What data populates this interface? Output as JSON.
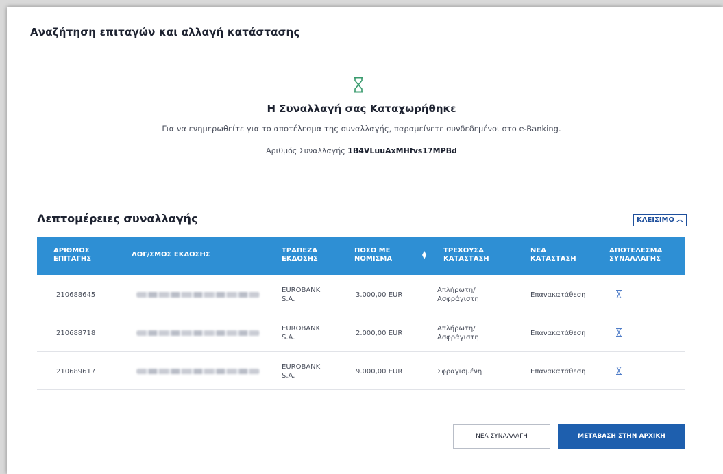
{
  "page": {
    "title": "Αναζήτηση επιταγών και αλλαγή κατάστασης"
  },
  "status": {
    "icon": "hourglass-icon",
    "title": "Η Συναλλαγή σας Καταχωρήθηκε",
    "subtitle": "Για να ενημερωθείτε για το αποτέλεσμα της συναλλαγής, παραμείνετε συνδεδεμένοι στο e-Banking.",
    "tx_label": "Αριθμός Συναλλαγής",
    "tx_id": "1B4VLuuAxMHfvs17MPBd"
  },
  "details": {
    "title": "Λεπτομέρειες συναλλαγής",
    "close_label": "ΚΛΕΙΣΙΜΟ"
  },
  "table": {
    "headers": {
      "check_no": [
        "ΑΡΙΘΜΟΣ",
        "ΕΠΙΤΑΓΗΣ"
      ],
      "account": [
        "ΛΟΓ/ΣΜΟΣ ΕΚΔΟΣΗΣ"
      ],
      "bank": [
        "ΤΡΑΠΕΖΑ",
        "ΕΚΔΟΣΗΣ"
      ],
      "amount": [
        "ΠΟΣΟ ΜΕ",
        "ΝΟΜΙΣΜΑ"
      ],
      "current": [
        "ΤΡΕΧΟΥΣΑ",
        "ΚΑΤΑΣΤΑΣΗ"
      ],
      "new_state": [
        "ΝΕΑ",
        "ΚΑΤΑΣΤΑΣΗ"
      ],
      "result": [
        "ΑΠΟΤΕΛΕΣΜΑ",
        "ΣΥΝΑΛΛΑΓΗΣ"
      ]
    },
    "rows": [
      {
        "check_no": "210688645",
        "bank": [
          "EUROBANK",
          "S.A."
        ],
        "amount": "3.000,00 EUR",
        "current": [
          "Απλήρωτη/",
          "Ασφράγιστη"
        ],
        "new_state": "Επανακατάθεση"
      },
      {
        "check_no": "210688718",
        "bank": [
          "EUROBANK",
          "S.A."
        ],
        "amount": "2.000,00 EUR",
        "current": [
          "Απλήρωτη/",
          "Ασφράγιστη"
        ],
        "new_state": "Επανακατάθεση"
      },
      {
        "check_no": "210689617",
        "bank": [
          "EUROBANK",
          "S.A."
        ],
        "amount": "9.000,00 EUR",
        "current": [
          "Σφραγισμένη"
        ],
        "new_state": "Επανακατάθεση"
      }
    ]
  },
  "buttons": {
    "new_tx": "ΝΕΑ ΣΥΝΑΛΛΑΓΗ",
    "home": "ΜΕΤΑΒΑΣΗ ΣΤΗΝ ΑΡΧΙΚΗ"
  },
  "colors": {
    "header_blue": "#2e8fd4",
    "primary_button": "#1e5fae",
    "hourglass_green": "#3a9b6e"
  }
}
